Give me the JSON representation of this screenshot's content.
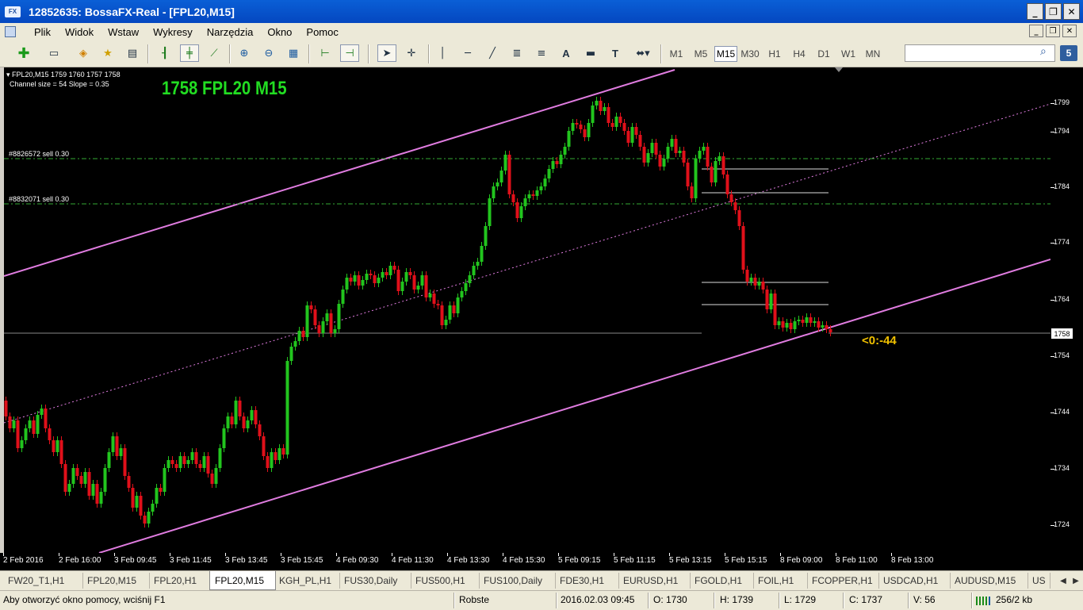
{
  "window": {
    "app_icon": "FX",
    "title": "12852635: BossaFX-Real - [FPL20,M15]",
    "controls": [
      "_",
      "❐",
      "✕"
    ]
  },
  "menu": [
    "Plik",
    "Widok",
    "Wstaw",
    "Wykresy",
    "Narzędzia",
    "Okno",
    "Pomoc"
  ],
  "mdi_controls": [
    "_",
    "❐",
    "✕"
  ],
  "toolbar": {
    "timeframes": [
      "M1",
      "M5",
      "M15",
      "M30",
      "H1",
      "H4",
      "D1",
      "W1",
      "MN"
    ],
    "active_timeframe": "M15",
    "text_tool": "A",
    "label_tool": "T",
    "notifications": "5",
    "search_value": ""
  },
  "chart": {
    "symbol_info": "FPL20,M15  1759 1760 1757 1758",
    "channel_info": "Channel size = 54 Slope = 0.35",
    "big_title": "1758 FPL20 M15",
    "orders": [
      "#8826572 sell 0.30",
      "#8832071 sell 0.30"
    ],
    "distance_label": "<0:-44",
    "current_price": "1758",
    "colors": {
      "bull": "#22c51e",
      "bear": "#e0101a",
      "channel": "#e07ce0",
      "order_line": "#33aa33",
      "title": "#22dd22",
      "label": "#f0c000"
    },
    "price_ticks": [
      "1799",
      "1794",
      "1784",
      "1774",
      "1764",
      "1754",
      "1744",
      "1734",
      "1724"
    ],
    "time_ticks": [
      "2 Feb 2016",
      "2 Feb 16:00",
      "3 Feb 09:45",
      "3 Feb 11:45",
      "3 Feb 13:45",
      "3 Feb 15:45",
      "4 Feb 09:30",
      "4 Feb 11:30",
      "4 Feb 13:30",
      "4 Feb 15:30",
      "5 Feb 09:15",
      "5 Feb 11:15",
      "5 Feb 13:15",
      "5 Feb 15:15",
      "8 Feb 09:00",
      "8 Feb 11:00",
      "8 Feb 13:00"
    ]
  },
  "tabs": [
    "FW20_T1,H1",
    "FPL20,M15",
    "FPL20,H1",
    "FPL20,M15",
    "KGH_PL,H1",
    "FUS30,Daily",
    "FUS500,H1",
    "FUS100,Daily",
    "FDE30,H1",
    "EURUSD,H1",
    "FGOLD,H1",
    "FOIL,H1",
    "FCOPPER,H1",
    "USDCAD,H1",
    "AUDUSD,M15",
    "US"
  ],
  "active_tab_index": 3,
  "status": {
    "help": "Aby otworzyć okno pomocy, wciśnij F1",
    "profile": "Robste",
    "datetime": "2016.02.03 09:45",
    "open": "O: 1730",
    "high": "H: 1739",
    "low": "L: 1729",
    "close": "C: 1737",
    "volume": "V: 56",
    "traffic": "256/2 kb"
  }
}
